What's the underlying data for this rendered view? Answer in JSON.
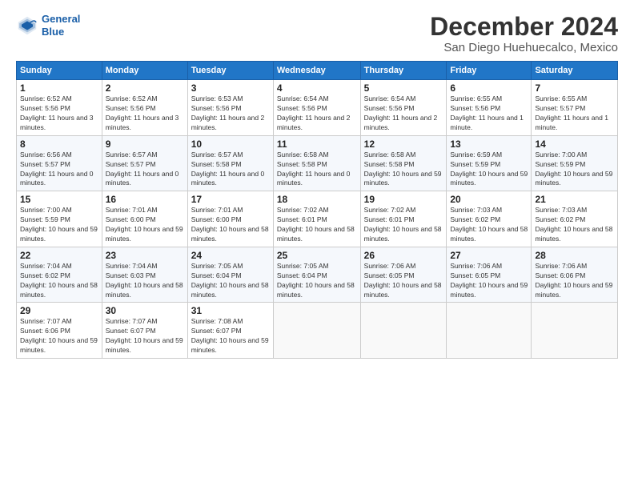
{
  "logo": {
    "line1": "General",
    "line2": "Blue"
  },
  "title": "December 2024",
  "subtitle": "San Diego Huehuecalco, Mexico",
  "headers": [
    "Sunday",
    "Monday",
    "Tuesday",
    "Wednesday",
    "Thursday",
    "Friday",
    "Saturday"
  ],
  "weeks": [
    [
      {
        "day": "1",
        "info": "Sunrise: 6:52 AM\nSunset: 5:56 PM\nDaylight: 11 hours and 3 minutes."
      },
      {
        "day": "2",
        "info": "Sunrise: 6:52 AM\nSunset: 5:56 PM\nDaylight: 11 hours and 3 minutes."
      },
      {
        "day": "3",
        "info": "Sunrise: 6:53 AM\nSunset: 5:56 PM\nDaylight: 11 hours and 2 minutes."
      },
      {
        "day": "4",
        "info": "Sunrise: 6:54 AM\nSunset: 5:56 PM\nDaylight: 11 hours and 2 minutes."
      },
      {
        "day": "5",
        "info": "Sunrise: 6:54 AM\nSunset: 5:56 PM\nDaylight: 11 hours and 2 minutes."
      },
      {
        "day": "6",
        "info": "Sunrise: 6:55 AM\nSunset: 5:56 PM\nDaylight: 11 hours and 1 minute."
      },
      {
        "day": "7",
        "info": "Sunrise: 6:55 AM\nSunset: 5:57 PM\nDaylight: 11 hours and 1 minute."
      }
    ],
    [
      {
        "day": "8",
        "info": "Sunrise: 6:56 AM\nSunset: 5:57 PM\nDaylight: 11 hours and 0 minutes."
      },
      {
        "day": "9",
        "info": "Sunrise: 6:57 AM\nSunset: 5:57 PM\nDaylight: 11 hours and 0 minutes."
      },
      {
        "day": "10",
        "info": "Sunrise: 6:57 AM\nSunset: 5:58 PM\nDaylight: 11 hours and 0 minutes."
      },
      {
        "day": "11",
        "info": "Sunrise: 6:58 AM\nSunset: 5:58 PM\nDaylight: 11 hours and 0 minutes."
      },
      {
        "day": "12",
        "info": "Sunrise: 6:58 AM\nSunset: 5:58 PM\nDaylight: 10 hours and 59 minutes."
      },
      {
        "day": "13",
        "info": "Sunrise: 6:59 AM\nSunset: 5:59 PM\nDaylight: 10 hours and 59 minutes."
      },
      {
        "day": "14",
        "info": "Sunrise: 7:00 AM\nSunset: 5:59 PM\nDaylight: 10 hours and 59 minutes."
      }
    ],
    [
      {
        "day": "15",
        "info": "Sunrise: 7:00 AM\nSunset: 5:59 PM\nDaylight: 10 hours and 59 minutes."
      },
      {
        "day": "16",
        "info": "Sunrise: 7:01 AM\nSunset: 6:00 PM\nDaylight: 10 hours and 59 minutes."
      },
      {
        "day": "17",
        "info": "Sunrise: 7:01 AM\nSunset: 6:00 PM\nDaylight: 10 hours and 58 minutes."
      },
      {
        "day": "18",
        "info": "Sunrise: 7:02 AM\nSunset: 6:01 PM\nDaylight: 10 hours and 58 minutes."
      },
      {
        "day": "19",
        "info": "Sunrise: 7:02 AM\nSunset: 6:01 PM\nDaylight: 10 hours and 58 minutes."
      },
      {
        "day": "20",
        "info": "Sunrise: 7:03 AM\nSunset: 6:02 PM\nDaylight: 10 hours and 58 minutes."
      },
      {
        "day": "21",
        "info": "Sunrise: 7:03 AM\nSunset: 6:02 PM\nDaylight: 10 hours and 58 minutes."
      }
    ],
    [
      {
        "day": "22",
        "info": "Sunrise: 7:04 AM\nSunset: 6:02 PM\nDaylight: 10 hours and 58 minutes."
      },
      {
        "day": "23",
        "info": "Sunrise: 7:04 AM\nSunset: 6:03 PM\nDaylight: 10 hours and 58 minutes."
      },
      {
        "day": "24",
        "info": "Sunrise: 7:05 AM\nSunset: 6:04 PM\nDaylight: 10 hours and 58 minutes."
      },
      {
        "day": "25",
        "info": "Sunrise: 7:05 AM\nSunset: 6:04 PM\nDaylight: 10 hours and 58 minutes."
      },
      {
        "day": "26",
        "info": "Sunrise: 7:06 AM\nSunset: 6:05 PM\nDaylight: 10 hours and 58 minutes."
      },
      {
        "day": "27",
        "info": "Sunrise: 7:06 AM\nSunset: 6:05 PM\nDaylight: 10 hours and 59 minutes."
      },
      {
        "day": "28",
        "info": "Sunrise: 7:06 AM\nSunset: 6:06 PM\nDaylight: 10 hours and 59 minutes."
      }
    ],
    [
      {
        "day": "29",
        "info": "Sunrise: 7:07 AM\nSunset: 6:06 PM\nDaylight: 10 hours and 59 minutes."
      },
      {
        "day": "30",
        "info": "Sunrise: 7:07 AM\nSunset: 6:07 PM\nDaylight: 10 hours and 59 minutes."
      },
      {
        "day": "31",
        "info": "Sunrise: 7:08 AM\nSunset: 6:07 PM\nDaylight: 10 hours and 59 minutes."
      },
      null,
      null,
      null,
      null
    ]
  ]
}
